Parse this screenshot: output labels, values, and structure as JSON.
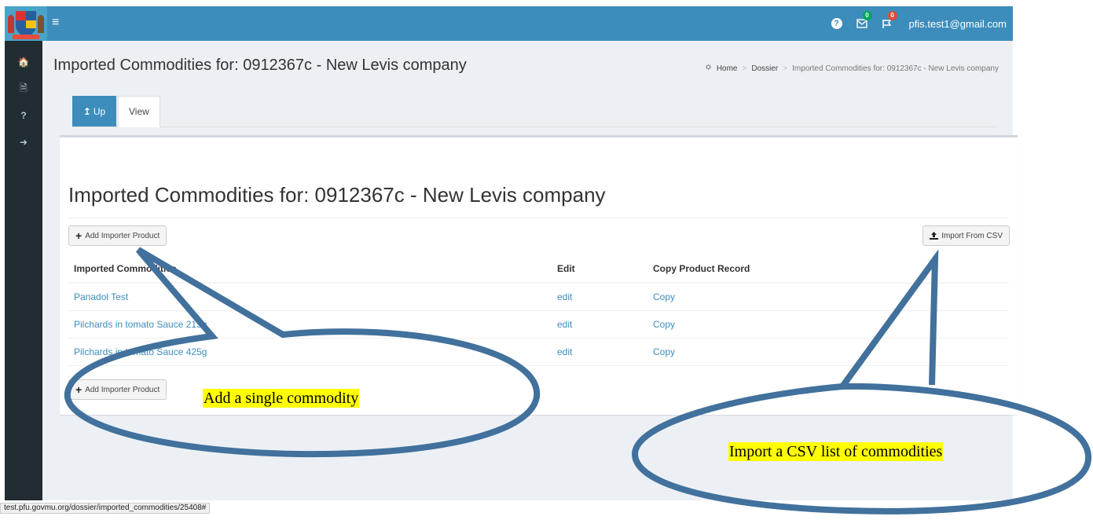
{
  "header": {
    "menu_icon": "hamburger-icon",
    "help_icon": "question-circle-icon",
    "messages": {
      "icon": "envelope-icon",
      "count": "0",
      "color": "#00a65a"
    },
    "flags": {
      "icon": "flag-icon",
      "count": "0",
      "color": "#dd4b39"
    },
    "user_email": "pfis.test1@gmail.com"
  },
  "sidebar": {
    "items": [
      {
        "icon": "home-icon",
        "glyph": "🏠"
      },
      {
        "icon": "pdf-file-icon",
        "glyph": "🗎"
      },
      {
        "icon": "question-icon",
        "glyph": "?"
      },
      {
        "icon": "sign-out-icon",
        "glyph": "➜"
      }
    ]
  },
  "page": {
    "title": "Imported Commodities for: 0912367c - New Levis company",
    "breadcrumb": {
      "home": "Home",
      "dossier": "Dossier",
      "current": "Imported Commodities for: 0912367c - New Levis company"
    }
  },
  "tabs": {
    "up": "Up",
    "view": "View"
  },
  "box": {
    "title": "Imported Commodities for: 0912367c - New Levis company",
    "add_button": "Add Importer Product",
    "import_button": "Import From CSV",
    "columns": [
      "Imported Commodities",
      "Edit",
      "Copy Product Record"
    ],
    "rows": [
      {
        "name": "Panadol Test",
        "edit": "edit",
        "copy": "Copy"
      },
      {
        "name": "Pilchards in tomato Sauce 215g",
        "edit": "edit",
        "copy": "Copy"
      },
      {
        "name": "Pilchards in tomato Sauce 425g",
        "edit": "edit",
        "copy": "Copy"
      }
    ],
    "add_button_bottom": "Add Importer Product"
  },
  "statusbar": {
    "url": "test.pfu.govmu.org/dossier/imported_commodities/25408#"
  },
  "annotations": {
    "left": "Add a single commodity",
    "right": "Import a CSV list of commodities",
    "color": "#41719c",
    "highlight": "#ffff00"
  }
}
